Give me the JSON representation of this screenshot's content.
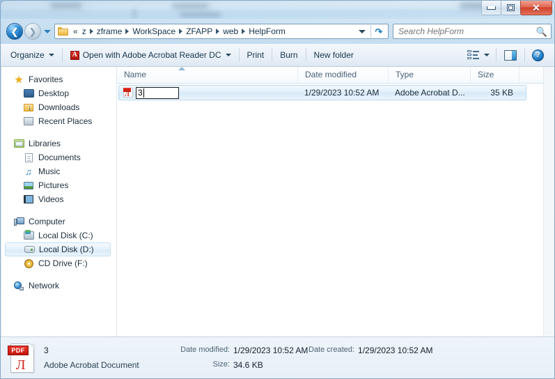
{
  "window": {
    "controls": {
      "minimize": "Minimize",
      "restore": "Restore Down",
      "close": "Close"
    }
  },
  "addressbar": {
    "back_label": "Back",
    "forward_label": "Forward",
    "recent_label": "Recent pages",
    "overflow": "«",
    "crumbs": [
      "z",
      "zframe",
      "WorkSpace",
      "ZFAPP",
      "web",
      "HelpForm"
    ],
    "refresh_label": "Refresh"
  },
  "search": {
    "value": "",
    "placeholder": "Search HelpForm",
    "icon": "search-icon"
  },
  "toolbar": {
    "organize": "Organize",
    "open_with": "Open with Adobe Acrobat Reader DC",
    "acrobat_badge": "A",
    "print": "Print",
    "burn": "Burn",
    "new_folder": "New folder",
    "change_view": "Change your view",
    "preview_pane": "Show the preview pane",
    "help": "?"
  },
  "navpane": {
    "sections": [
      {
        "header": {
          "label": "Favorites",
          "icon": "star-icon"
        },
        "items": [
          {
            "label": "Desktop",
            "icon": "desktop-icon"
          },
          {
            "label": "Downloads",
            "icon": "downloads-icon"
          },
          {
            "label": "Recent Places",
            "icon": "recent-places-icon"
          }
        ]
      },
      {
        "header": {
          "label": "Libraries",
          "icon": "libraries-icon"
        },
        "items": [
          {
            "label": "Documents",
            "icon": "documents-icon"
          },
          {
            "label": "Music",
            "icon": "music-icon"
          },
          {
            "label": "Pictures",
            "icon": "pictures-icon"
          },
          {
            "label": "Videos",
            "icon": "videos-icon"
          }
        ]
      },
      {
        "header": {
          "label": "Computer",
          "icon": "computer-icon"
        },
        "items": [
          {
            "label": "Local Disk (C:)",
            "icon": "local-disk-c-icon",
            "selected": false
          },
          {
            "label": "Local Disk (D:)",
            "icon": "local-disk-d-icon",
            "selected": true
          },
          {
            "label": "CD Drive (F:)",
            "icon": "cd-drive-icon",
            "selected": false
          }
        ]
      },
      {
        "header": {
          "label": "Network",
          "icon": "network-icon"
        },
        "items": []
      }
    ]
  },
  "filelist": {
    "columns": [
      {
        "key": "name",
        "label": "Name"
      },
      {
        "key": "date",
        "label": "Date modified"
      },
      {
        "key": "type",
        "label": "Type"
      },
      {
        "key": "size",
        "label": "Size"
      }
    ],
    "sorted_by": "Name",
    "rows": [
      {
        "name": "3",
        "date": "1/29/2023 10:52 AM",
        "type": "Adobe Acrobat D...",
        "size": "35 KB",
        "icon": "pdf-file-icon",
        "selected": true,
        "renaming": true
      }
    ],
    "rename_value": "3"
  },
  "details": {
    "icon": "pdf-file-icon",
    "badge": "PDF",
    "name": "3",
    "type": "Adobe Acrobat Document",
    "date_modified_label": "Date modified:",
    "date_modified_value": "1/29/2023 10:52 AM",
    "size_label": "Size:",
    "size_value": "34.6 KB",
    "date_created_label": "Date created:",
    "date_created_value": "1/29/2023 10:52 AM"
  },
  "colors": {
    "accent": "#2f8fd8",
    "selection": "#d6e9f8",
    "acrobat_red": "#d0251a",
    "close_red": "#d0402a"
  }
}
